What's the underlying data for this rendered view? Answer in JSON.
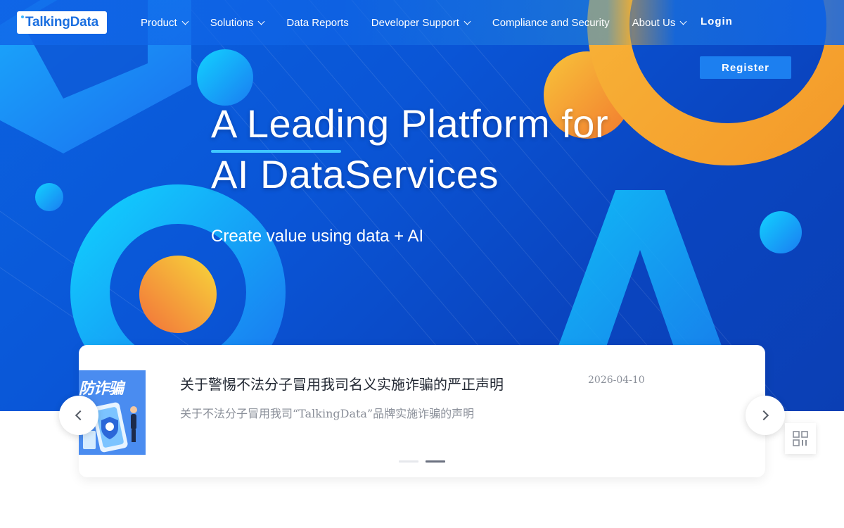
{
  "nav": {
    "logo": "TalkingData",
    "items": [
      {
        "label": "Product",
        "dropdown": true
      },
      {
        "label": "Solutions",
        "dropdown": true
      },
      {
        "label": "Data Reports",
        "dropdown": false
      },
      {
        "label": "Developer Support",
        "dropdown": true
      },
      {
        "label": "Compliance and Security",
        "dropdown": false
      },
      {
        "label": "About Us",
        "dropdown": true
      }
    ],
    "login": "Login",
    "register": "Register"
  },
  "hero": {
    "title_line1": "A Leading Platform for",
    "title_line2": "AI DataServices",
    "subtitle": "Create value using data + AI"
  },
  "news": {
    "thumb_text": "防诈骗",
    "title": "关于警惕不法分子冒用我司名义实施诈骗的严正声明",
    "date": "2026-04-10",
    "description": "关于不法分子冒用我司“TalkingData”品牌实施诈骗的声明",
    "slide_count": 2,
    "active_slide": 2
  },
  "icons": {
    "prev": "chevron-left-icon",
    "next": "chevron-right-icon",
    "qr": "qr-code-icon"
  },
  "colors": {
    "hero_blue": "#0a55d6",
    "accent_cyan": "#3fc6ff",
    "orange": "#f5a623",
    "logo_blue": "#1a6fe0"
  }
}
